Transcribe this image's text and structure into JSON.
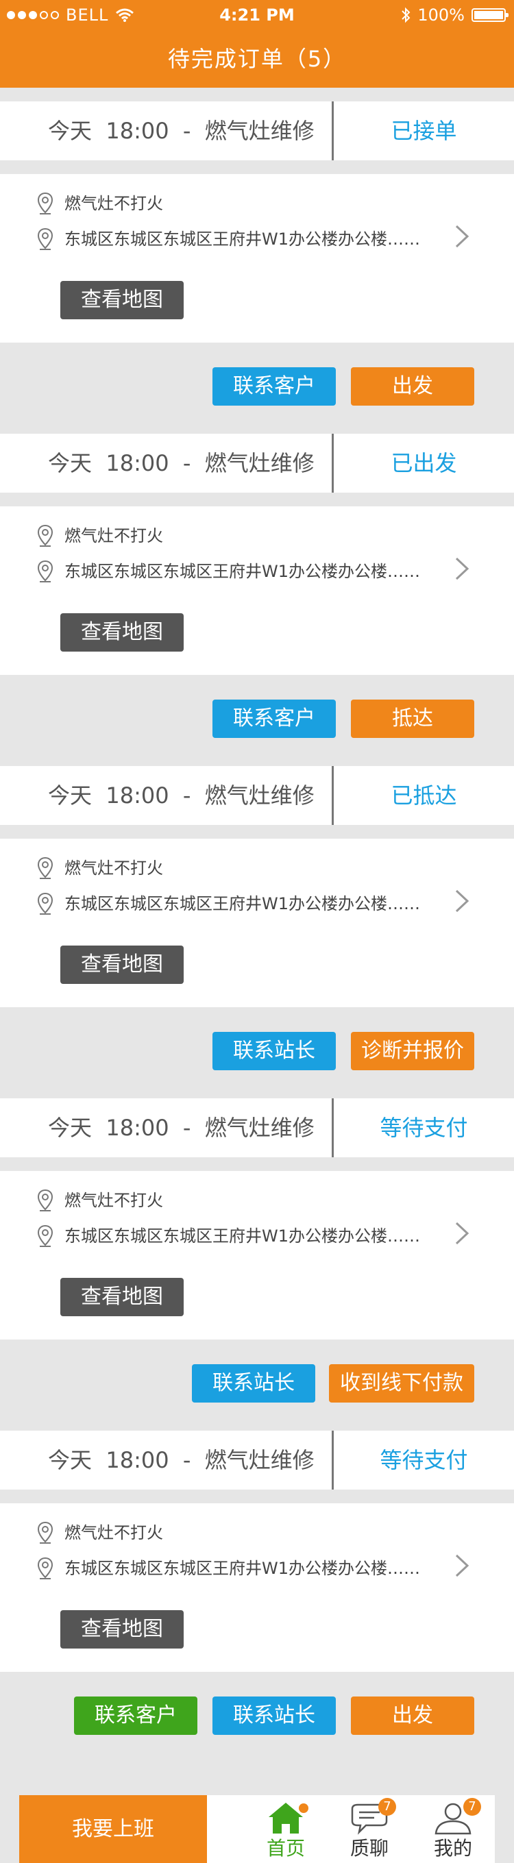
{
  "status_bar": {
    "carrier": "BELL",
    "time": "4:21 PM",
    "battery": "100%",
    "signal_icon": "signal-dots-icon",
    "wifi_icon": "wifi-icon",
    "bluetooth_icon": "bluetooth-icon",
    "battery_icon": "battery-icon"
  },
  "header": {
    "title": "待完成订单（5）"
  },
  "orders": [
    {
      "time": "今天  18:00  -  燃气灶维修",
      "status": "已接单",
      "issue": "燃气灶不打火",
      "address": "东城区东城区东城区王府井W1办公楼办公楼……",
      "map_button": "查看地图",
      "actions": [
        {
          "label": "联系客户",
          "color": "blue"
        },
        {
          "label": "出发",
          "color": "orange"
        }
      ]
    },
    {
      "time": "今天  18:00  -  燃气灶维修",
      "status": "已出发",
      "issue": "燃气灶不打火",
      "address": "东城区东城区东城区王府井W1办公楼办公楼……",
      "map_button": "查看地图",
      "actions": [
        {
          "label": "联系客户",
          "color": "blue"
        },
        {
          "label": "抵达",
          "color": "orange"
        }
      ]
    },
    {
      "time": "今天  18:00  -  燃气灶维修",
      "status": "已抵达",
      "issue": "燃气灶不打火",
      "address": "东城区东城区东城区王府井W1办公楼办公楼……",
      "map_button": "查看地图",
      "actions": [
        {
          "label": "联系站长",
          "color": "blue"
        },
        {
          "label": "诊断并报价",
          "color": "orange"
        }
      ]
    },
    {
      "time": "今天  18:00  -  燃气灶维修",
      "status": "等待支付",
      "issue": "燃气灶不打火",
      "address": "东城区东城区东城区王府井W1办公楼办公楼……",
      "map_button": "查看地图",
      "actions": [
        {
          "label": "联系站长",
          "color": "blue"
        },
        {
          "label": "收到线下付款",
          "color": "orange"
        }
      ]
    },
    {
      "time": "今天  18:00  -  燃气灶维修",
      "status": "等待支付",
      "issue": "燃气灶不打火",
      "address": "东城区东城区东城区王府井W1办公楼办公楼……",
      "map_button": "查看地图",
      "actions": [
        {
          "label": "联系客户",
          "color": "green"
        },
        {
          "label": "联系站长",
          "color": "blue"
        },
        {
          "label": "出发",
          "color": "orange"
        }
      ]
    }
  ],
  "bottom_bar": {
    "work_button": "我要上班",
    "tabs": [
      {
        "label": "首页",
        "icon": "home-icon",
        "active": true,
        "badge": ""
      },
      {
        "label": "质聊",
        "icon": "chat-icon",
        "active": false,
        "badge": "7"
      },
      {
        "label": "我的",
        "icon": "profile-icon",
        "active": false,
        "badge": "7"
      }
    ]
  },
  "colors": {
    "accent_orange": "#f0861a",
    "accent_blue": "#1aa0e0",
    "accent_green": "#3fa51c",
    "map_button": "#555555",
    "background": "#e6e6e6"
  }
}
